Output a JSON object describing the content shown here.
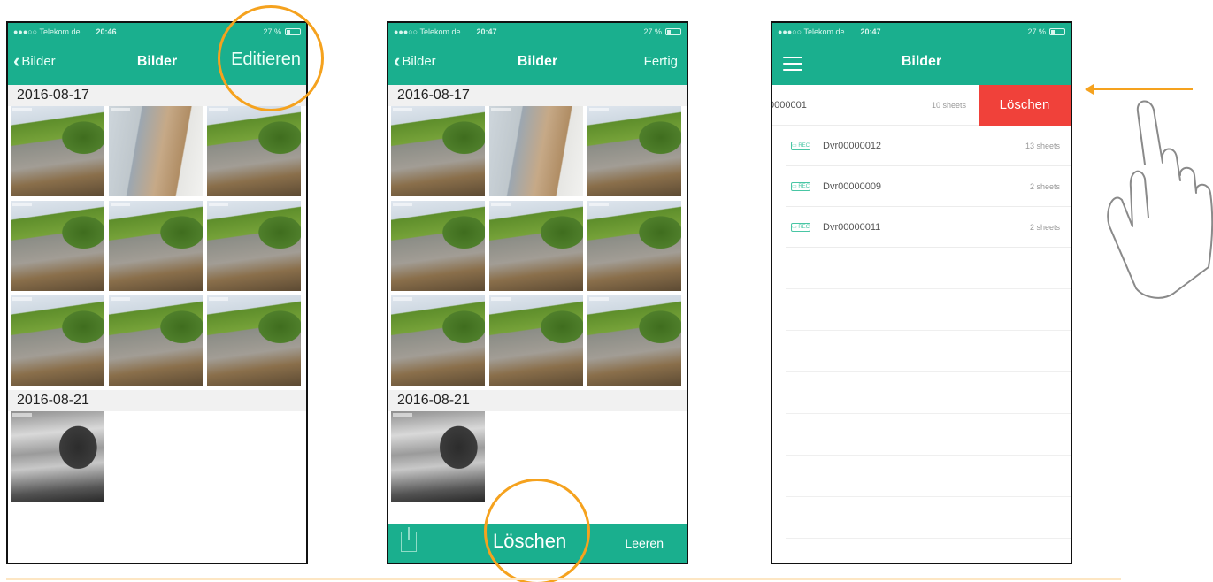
{
  "panel1": {
    "status": {
      "carrier": "●●●○○ Telekom.de",
      "time": "20:46",
      "battery": "27 %"
    },
    "nav": {
      "back_label": "Bilder",
      "title": "Bilder",
      "right_label": "Editieren"
    },
    "sections": [
      {
        "date": "2016-08-17",
        "thumb_count": 9
      },
      {
        "date": "2016-08-21",
        "thumb_count": 1
      }
    ]
  },
  "panel2": {
    "status": {
      "carrier": "●●●○○ Telekom.de",
      "time": "20:47",
      "battery": "27 %"
    },
    "nav": {
      "back_label": "Bilder",
      "title": "Bilder",
      "right_label": "Fertig"
    },
    "sections": [
      {
        "date": "2016-08-17",
        "thumb_count": 9
      },
      {
        "date": "2016-08-21",
        "thumb_count": 1
      }
    ],
    "bottombar": {
      "delete_label": "Löschen",
      "clear_label": "Leeren"
    }
  },
  "panel3": {
    "status": {
      "carrier": "●●●○○ Telekom.de",
      "time": "20:47",
      "battery": "27 %"
    },
    "nav": {
      "title": "Bilder"
    },
    "rows": [
      {
        "name": "0000001",
        "count": "10 sheets",
        "swiped": true,
        "action_label": "Löschen"
      },
      {
        "name": "Dvr00000012",
        "count": "13 sheets",
        "swiped": false
      },
      {
        "name": "Dvr00000009",
        "count": "2 sheets",
        "swiped": false
      },
      {
        "name": "Dvr00000011",
        "count": "2 sheets",
        "swiped": false
      }
    ],
    "file_icon_label": "▭ REC"
  },
  "colors": {
    "accent": "#1aaf8e",
    "highlight": "#f5a21e",
    "delete": "#f0413a"
  },
  "icons": {
    "back": "chevron-left-icon",
    "menu": "hamburger-icon",
    "share": "share-icon",
    "hand": "swipe-hand-icon",
    "file": "file-icon"
  }
}
